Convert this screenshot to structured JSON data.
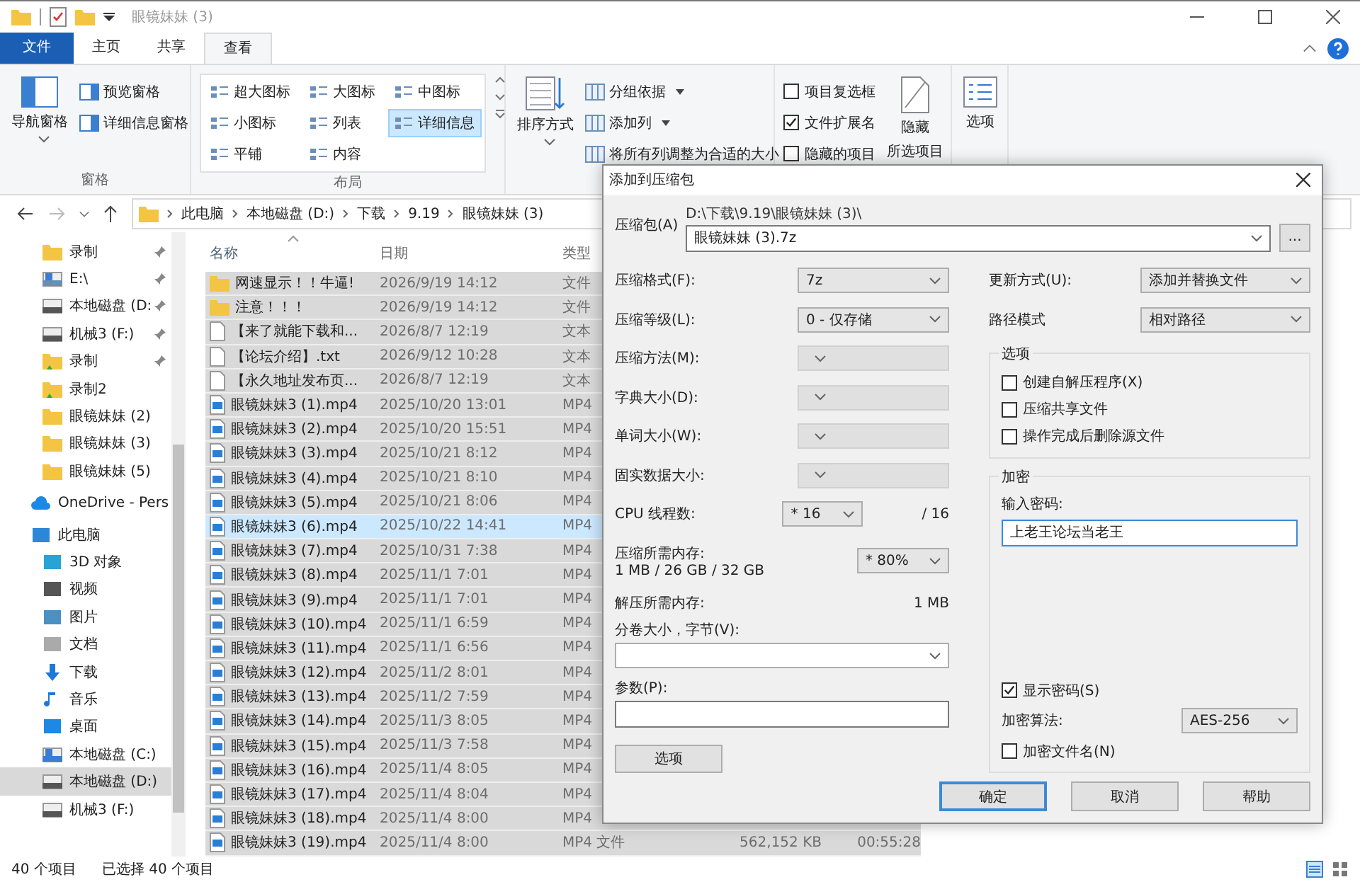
{
  "window": {
    "title": "眼镜妹妹 (3)"
  },
  "ribbon_tabs": [
    {
      "label": "文件",
      "kind": "file",
      "selected": false
    },
    {
      "label": "主页",
      "kind": "tab",
      "selected": false
    },
    {
      "label": "共享",
      "kind": "tab",
      "selected": false
    },
    {
      "label": "查看",
      "kind": "tab",
      "selected": true
    }
  ],
  "panes": {
    "label": "窗格",
    "nav": "导航窗格",
    "items": [
      "预览窗格",
      "详细信息窗格"
    ]
  },
  "layout": {
    "label": "布局",
    "items": [
      {
        "label": "超大图标",
        "selected": false
      },
      {
        "label": "大图标",
        "selected": false
      },
      {
        "label": "中图标",
        "selected": false
      },
      {
        "label": "小图标",
        "selected": false
      },
      {
        "label": "列表",
        "selected": false
      },
      {
        "label": "详细信息",
        "selected": true
      },
      {
        "label": "平铺",
        "selected": false
      },
      {
        "label": "内容",
        "selected": false
      }
    ]
  },
  "current_view": {
    "sort": "排序方式",
    "items": [
      {
        "label": "分组依据",
        "dropdown": true
      },
      {
        "label": "添加列",
        "dropdown": true
      },
      {
        "label": "将所有列调整为合适的大小",
        "dropdown": false
      }
    ]
  },
  "show_hide": {
    "checkboxes": [
      {
        "label": "项目复选框",
        "checked": false
      },
      {
        "label": "文件扩展名",
        "checked": true
      },
      {
        "label": "隐藏的项目",
        "checked": false
      }
    ],
    "hide_selected": [
      "隐藏",
      "所选项目"
    ]
  },
  "options": "选项",
  "address": {
    "crumbs": [
      "此电脑",
      "本地磁盘 (D:)",
      "下载",
      "9.19",
      "眼镜妹妹 (3)"
    ]
  },
  "nav_pane": {
    "items": [
      {
        "label": "录制",
        "kind": "folder",
        "pinned": true,
        "selected": false
      },
      {
        "label": "E:\\",
        "kind": "netdrive",
        "pinned": true,
        "selected": false
      },
      {
        "label": "本地磁盘 (D:",
        "kind": "drive",
        "pinned": true,
        "selected": false
      },
      {
        "label": "机械3 (F:)",
        "kind": "drive",
        "pinned": true,
        "selected": false
      },
      {
        "label": "录制",
        "kind": "media",
        "pinned": true,
        "selected": false
      },
      {
        "label": "录制2",
        "kind": "media",
        "pinned": false,
        "selected": false
      },
      {
        "label": "眼镜妹妹 (2)",
        "kind": "folder",
        "pinned": false,
        "selected": false
      },
      {
        "label": "眼镜妹妹 (3)",
        "kind": "folder",
        "pinned": false,
        "selected": false
      },
      {
        "label": "眼镜妹妹 (5)",
        "kind": "folder",
        "pinned": false,
        "selected": false
      },
      {
        "label": "OneDrive - Pers",
        "kind": "cloud",
        "pinned": false,
        "selected": false
      },
      {
        "label": "此电脑",
        "kind": "pc",
        "pinned": false,
        "selected": false
      },
      {
        "label": "3D 对象",
        "kind": "cube",
        "pinned": false,
        "selected": false
      },
      {
        "label": "视频",
        "kind": "video",
        "pinned": false,
        "selected": false
      },
      {
        "label": "图片",
        "kind": "picture",
        "pinned": false,
        "selected": false
      },
      {
        "label": "文档",
        "kind": "doc",
        "pinned": false,
        "selected": false
      },
      {
        "label": "下载",
        "kind": "download",
        "pinned": false,
        "selected": false
      },
      {
        "label": "音乐",
        "kind": "music",
        "pinned": false,
        "selected": false
      },
      {
        "label": "桌面",
        "kind": "desktop",
        "pinned": false,
        "selected": false
      },
      {
        "label": "本地磁盘 (C:)",
        "kind": "sysdrive",
        "pinned": false,
        "selected": false
      },
      {
        "label": "本地磁盘 (D:)",
        "kind": "drive",
        "pinned": false,
        "selected": true
      },
      {
        "label": "机械3 (F:)",
        "kind": "drive",
        "pinned": false,
        "selected": false
      }
    ]
  },
  "file_list": {
    "columns": [
      "名称",
      "日期",
      "类型"
    ],
    "rows": [
      {
        "name": "网速显示！！牛逼!",
        "kind": "folder",
        "date": "2026/9/19 14:12",
        "type": "文件",
        "selected": true,
        "focused": false
      },
      {
        "name": "注意！！！",
        "kind": "folder",
        "date": "2026/9/19 14:12",
        "type": "文件",
        "selected": true,
        "focused": false
      },
      {
        "name": "【来了就能下载和...",
        "kind": "text",
        "date": "2026/8/7 12:19",
        "type": "文本",
        "selected": true,
        "focused": false
      },
      {
        "name": "【论坛介绍】.txt",
        "kind": "text",
        "date": "2026/9/12 10:28",
        "type": "文本",
        "selected": true,
        "focused": false
      },
      {
        "name": "【永久地址发布页...",
        "kind": "text",
        "date": "2026/8/7 12:19",
        "type": "文本",
        "selected": true,
        "focused": false
      },
      {
        "name": "眼镜妹妹3 (1).mp4",
        "kind": "video",
        "date": "2025/10/20 13:01",
        "type": "MP4",
        "selected": true,
        "focused": false
      },
      {
        "name": "眼镜妹妹3 (2).mp4",
        "kind": "video",
        "date": "2025/10/20 15:51",
        "type": "MP4",
        "selected": true,
        "focused": false
      },
      {
        "name": "眼镜妹妹3 (3).mp4",
        "kind": "video",
        "date": "2025/10/21 8:12",
        "type": "MP4",
        "selected": true,
        "focused": false
      },
      {
        "name": "眼镜妹妹3 (4).mp4",
        "kind": "video",
        "date": "2025/10/21 8:10",
        "type": "MP4",
        "selected": true,
        "focused": false
      },
      {
        "name": "眼镜妹妹3 (5).mp4",
        "kind": "video",
        "date": "2025/10/21 8:06",
        "type": "MP4",
        "selected": true,
        "focused": false
      },
      {
        "name": "眼镜妹妹3 (6).mp4",
        "kind": "video",
        "date": "2025/10/22 14:41",
        "type": "MP4",
        "selected": true,
        "focused": true
      },
      {
        "name": "眼镜妹妹3 (7).mp4",
        "kind": "video",
        "date": "2025/10/31 7:38",
        "type": "MP4",
        "selected": true,
        "focused": false
      },
      {
        "name": "眼镜妹妹3 (8).mp4",
        "kind": "video",
        "date": "2025/11/1 7:01",
        "type": "MP4",
        "selected": true,
        "focused": false
      },
      {
        "name": "眼镜妹妹3 (9).mp4",
        "kind": "video",
        "date": "2025/11/1 7:01",
        "type": "MP4",
        "selected": true,
        "focused": false
      },
      {
        "name": "眼镜妹妹3 (10).mp4",
        "kind": "video",
        "date": "2025/11/1 6:59",
        "type": "MP4",
        "selected": true,
        "focused": false
      },
      {
        "name": "眼镜妹妹3 (11).mp4",
        "kind": "video",
        "date": "2025/11/1 6:56",
        "type": "MP4",
        "selected": true,
        "focused": false
      },
      {
        "name": "眼镜妹妹3 (12).mp4",
        "kind": "video",
        "date": "2025/11/2 8:01",
        "type": "MP4",
        "selected": true,
        "focused": false
      },
      {
        "name": "眼镜妹妹3 (13).mp4",
        "kind": "video",
        "date": "2025/11/2 7:59",
        "type": "MP4",
        "selected": true,
        "focused": false
      },
      {
        "name": "眼镜妹妹3 (14).mp4",
        "kind": "video",
        "date": "2025/11/3 8:05",
        "type": "MP4",
        "selected": true,
        "focused": false
      },
      {
        "name": "眼镜妹妹3 (15).mp4",
        "kind": "video",
        "date": "2025/11/3 7:58",
        "type": "MP4",
        "selected": true,
        "focused": false
      },
      {
        "name": "眼镜妹妹3 (16).mp4",
        "kind": "video",
        "date": "2025/11/4 8:05",
        "type": "MP4",
        "selected": true,
        "focused": false
      },
      {
        "name": "眼镜妹妹3 (17).mp4",
        "kind": "video",
        "date": "2025/11/4 8:04",
        "type": "MP4",
        "selected": true,
        "focused": false
      },
      {
        "name": "眼镜妹妹3 (18).mp4",
        "kind": "video",
        "date": "2025/11/4 8:00",
        "type": "MP4",
        "selected": true,
        "focused": false
      },
      {
        "name": "眼镜妹妹3 (19).mp4",
        "kind": "video",
        "date": "2025/11/4 8:00",
        "type": "MP4 文件",
        "size": "562,152 KB",
        "length": "00:55:28",
        "selected": true,
        "focused": false
      }
    ]
  },
  "status_bar": {
    "count": "40 个项目",
    "selection": "已选择 40 个项目"
  },
  "dialog": {
    "title": "添加到压缩包",
    "archive_label": "压缩包(A)",
    "archive_path": "D:\\下载\\9.19\\眼镜妹妹 (3)\\",
    "archive_name": "眼镜妹妹 (3).7z",
    "browse": "...",
    "left_fields": [
      {
        "label": "压缩格式(F):",
        "value": "7z",
        "disabled": false
      },
      {
        "label": "压缩等级(L):",
        "value": "0 - 仅存储",
        "disabled": false
      },
      {
        "label": "压缩方法(M):",
        "disabled": true
      },
      {
        "label": "字典大小(D):",
        "disabled": true
      },
      {
        "label": "单词大小(W):",
        "disabled": true
      },
      {
        "label": "固实数据大小:",
        "disabled": true
      }
    ],
    "cpu": {
      "label": "CPU 线程数:",
      "value": "* 16",
      "total": "/ 16"
    },
    "memory": {
      "label": "压缩所需内存:",
      "detail": "1 MB / 26 GB / 32 GB",
      "value": "* 80%"
    },
    "decompress": {
      "label": "解压所需内存:",
      "value": "1 MB"
    },
    "split": {
      "label": "分卷大小，字节(V):"
    },
    "params": {
      "label": "参数(P):"
    },
    "options_button": "选项",
    "update": {
      "label": "更新方式(U):",
      "value": "添加并替换文件"
    },
    "path_mode": {
      "label": "路径模式",
      "value": "相对路径"
    },
    "options_group": {
      "title": "选项",
      "checkboxes": [
        {
          "label": "创建自解压程序(X)",
          "checked": false
        },
        {
          "label": "压缩共享文件",
          "checked": false
        },
        {
          "label": "操作完成后删除源文件",
          "checked": false
        }
      ]
    },
    "encryption": {
      "title": "加密",
      "password_label": "输入密码:",
      "password": "上老王论坛当老王",
      "show_password": {
        "label": "显示密码(S)",
        "checked": true
      },
      "method_label": "加密算法:",
      "method": "AES-256",
      "encrypt_names": {
        "label": "加密文件名(N)",
        "checked": false
      }
    },
    "buttons": [
      {
        "label": "确定",
        "default": true
      },
      {
        "label": "取消",
        "default": false
      },
      {
        "label": "帮助",
        "default": false
      }
    ]
  }
}
